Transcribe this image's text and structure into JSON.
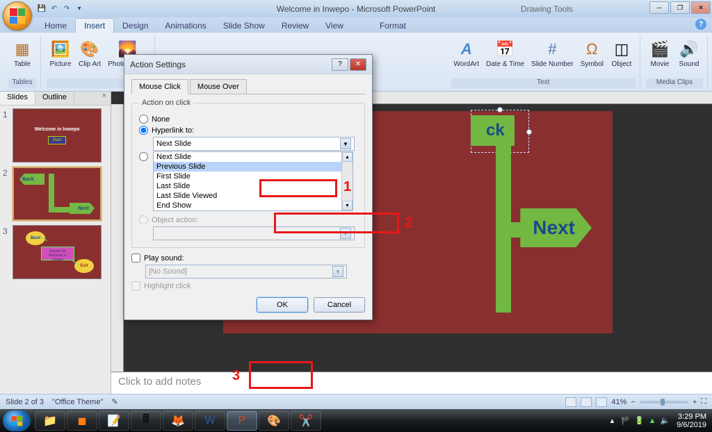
{
  "titlebar": {
    "title_center": "Welcome in Inwepo - Microsoft PowerPoint",
    "title_context": "Drawing Tools"
  },
  "ribbon": {
    "tabs": [
      "Home",
      "Insert",
      "Design",
      "Animations",
      "Slide Show",
      "Review",
      "View",
      "Format"
    ],
    "active_tab": 1,
    "groups": {
      "tables": {
        "label": "Tables",
        "table": "Table"
      },
      "illustrations": {
        "picture": "Picture",
        "clipart": "Clip\nArt",
        "album": "Photo\nAlbum"
      },
      "text": {
        "label": "Text",
        "wordart": "WordArt",
        "datetime": "Date\n& Time",
        "slidenum": "Slide\nNumber",
        "symbol": "Symbol",
        "object": "Object"
      },
      "media": {
        "label": "Media Clips",
        "movie": "Movie",
        "sound": "Sound"
      }
    }
  },
  "panel": {
    "tabs": {
      "slides": "Slides",
      "outline": "Outline"
    },
    "thumbs": {
      "s1_title": "Welcome in Inwepo",
      "s1_btn": "Start",
      "s2_back": "Back",
      "s2_next": "Next",
      "s3_back": "Back",
      "s3_exit": "Exit"
    }
  },
  "canvas": {
    "back_label": "ck",
    "next_label": "Next",
    "notes_placeholder": "Click to add notes"
  },
  "status": {
    "left": "Slide 2 of 3",
    "theme": "\"Office Theme\"",
    "zoom": "41%"
  },
  "dialog": {
    "title": "Action Settings",
    "tabs": {
      "click": "Mouse Click",
      "over": "Mouse Over"
    },
    "fieldset_label": "Action on click",
    "opt_none": "None",
    "opt_hyperlink": "Hyperlink to:",
    "hyperlink_value": "Next Slide",
    "list_items": [
      "Next Slide",
      "Previous Slide",
      "First Slide",
      "Last Slide",
      "Last Slide Viewed",
      "End Show"
    ],
    "opt_object": "Object action:",
    "chk_play": "Play sound:",
    "sound_value": "[No Sound]",
    "chk_highlight": "Highlight click",
    "btn_ok": "OK",
    "btn_cancel": "Cancel"
  },
  "annotations": {
    "a1": "1",
    "a2": "2",
    "a3": "3"
  },
  "tray": {
    "time": "3:29 PM",
    "date": "9/6/2019"
  }
}
